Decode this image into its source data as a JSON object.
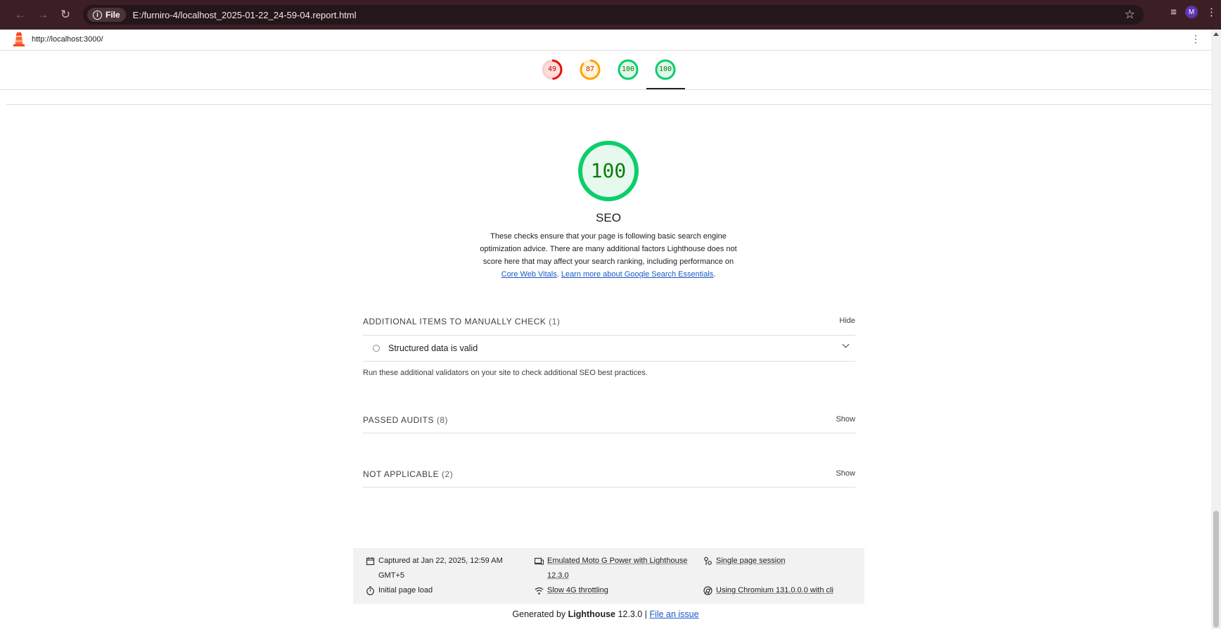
{
  "browser": {
    "chip_label": "File",
    "address": "E:/furniro-4/localhost_2025-01-22_24-59-04.report.html",
    "profile_initial": "M"
  },
  "report": {
    "url": "http://localhost:3000/"
  },
  "gauges": [
    {
      "value": "49",
      "score": 0.49,
      "color": "#eb0f00"
    },
    {
      "value": "87",
      "score": 0.87,
      "color": "#ffa400"
    },
    {
      "value": "100",
      "score": 1.0,
      "color": "#0cce6b"
    },
    {
      "value": "100",
      "score": 1.0,
      "color": "#0cce6b"
    }
  ],
  "category": {
    "score": "100",
    "title": "SEO",
    "description_1": "These checks ensure that your page is following basic search engine optimization advice. There are many additional factors Lighthouse does not score here that may affect your search ranking, including performance on ",
    "link_core_web_vitals": "Core Web Vitals",
    "sep": ". ",
    "link_search_essentials": "Learn more about Google Search Essentials",
    "end": "."
  },
  "groups": {
    "manual": {
      "title": "ADDITIONAL ITEMS TO MANUALLY CHECK",
      "count": "(1)",
      "toggle": "Hide"
    },
    "manual_audit": "Structured data is valid",
    "manual_desc": "Run these additional validators on your site to check additional SEO best practices.",
    "passed": {
      "title": "PASSED AUDITS",
      "count": "(8)",
      "toggle": "Show"
    },
    "not_applicable": {
      "title": "NOT APPLICABLE",
      "count": "(2)",
      "toggle": "Show"
    }
  },
  "environment": {
    "captured_line1": "Captured at Jan 22, 2025, 12:59 AM",
    "captured_line2": "GMT+5",
    "device_line1": "Emulated Moto G Power with Lighthouse",
    "device_line2": "12.3.0",
    "session": "Single page session",
    "load": "Initial page load",
    "throttling": "Slow 4G throttling",
    "chromium": "Using Chromium 131.0.0.0 with cli"
  },
  "footer": {
    "generated_by": "Generated by ",
    "product": "Lighthouse",
    "version": " 12.3.0 | ",
    "file_issue": "File an issue"
  }
}
